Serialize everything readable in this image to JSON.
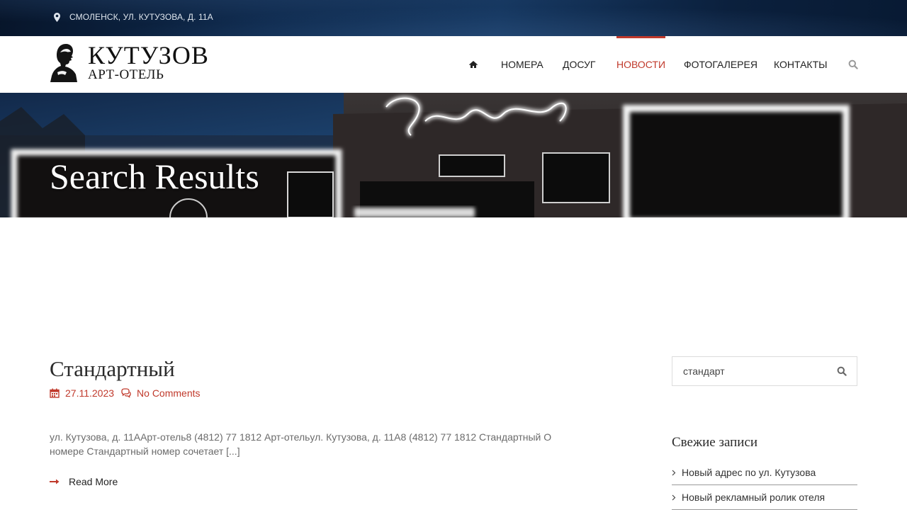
{
  "topbar": {
    "address": "СМОЛЕНСК, УЛ. КУТУЗОВА, Д. 11А",
    "pin_icon": "map-marker-icon"
  },
  "logo": {
    "line1": "КУТУЗОВ",
    "line2": "АРТ-ОТЕЛЬ"
  },
  "nav": {
    "home_icon": "home-icon",
    "items": [
      {
        "label": "НОМЕРА"
      },
      {
        "label": "ДОСУГ"
      },
      {
        "label": "НОВОСТИ",
        "active": true
      },
      {
        "label": "ФОТОГАЛЕРЕЯ"
      },
      {
        "label": "КОНТАКТЫ"
      }
    ],
    "search_icon": "search-icon"
  },
  "hero": {
    "title": "Search Results"
  },
  "post": {
    "title": "Стандартный",
    "date": "27.11.2023",
    "comments": "No Comments",
    "excerpt": "ул. Кутузова, д. 11ААрт-отель8 (4812) 77 1812 Арт-отельул. Кутузова, д. 11А8 (4812) 77 1812 Стандартный О номере Стандартный номер сочетает [...]",
    "read_more": "Read More"
  },
  "sidebar": {
    "search_value": "стандарт",
    "recent_title": "Свежие записи",
    "recent": [
      {
        "label": "Новый адрес по ул. Кутузова"
      },
      {
        "label": "Новый рекламный ролик отеля"
      }
    ]
  },
  "colors": {
    "accent": "#c0392b",
    "topbar": "#0e2a4e",
    "text": "#333333"
  }
}
